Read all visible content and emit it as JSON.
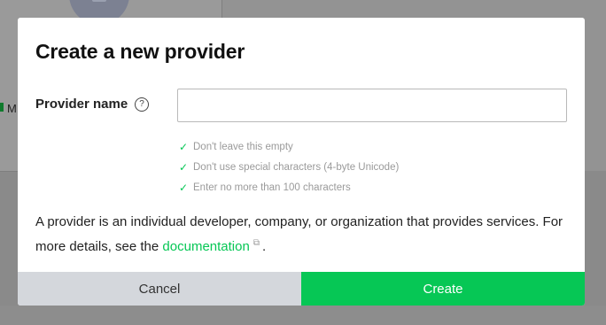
{
  "background": {
    "partial_text": "M"
  },
  "modal": {
    "title": "Create a new provider",
    "field_label": "Provider name",
    "help_icon": "?",
    "input_value": "",
    "input_placeholder": "",
    "rules": [
      {
        "icon": "check-icon",
        "text": "Don't leave this empty"
      },
      {
        "icon": "check-icon",
        "text": "Don't use special characters (4-byte Unicode)"
      },
      {
        "icon": "check-icon",
        "text": "Enter no more than 100 characters"
      }
    ],
    "description_before": "A provider is an individual developer, company, or organization that provides services. For more details, see the ",
    "description_link": "documentation",
    "description_after": ".",
    "cancel_label": "Cancel",
    "create_label": "Create"
  },
  "colors": {
    "accent": "#06c755",
    "cancel_bg": "#d4d7dc"
  }
}
